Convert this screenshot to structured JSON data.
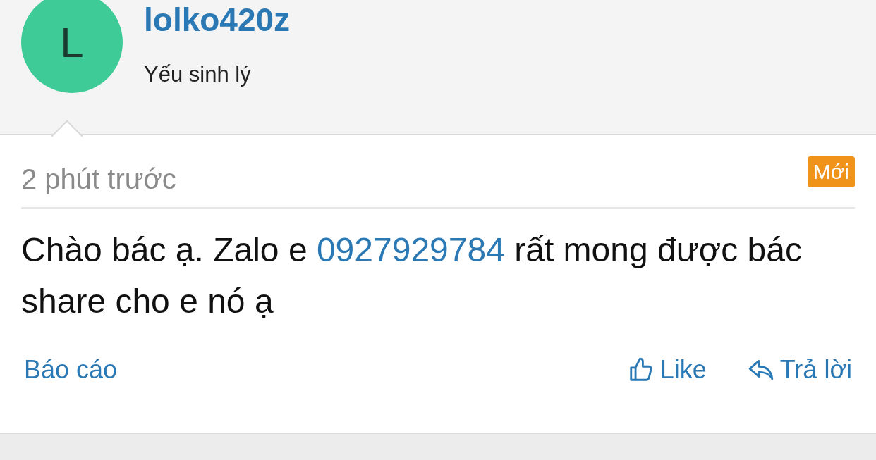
{
  "author": {
    "avatar_letter": "L",
    "username": "lolko420z",
    "title": "Yếu sinh lý"
  },
  "comment": {
    "time": "2 phút trước",
    "badge": "Mới",
    "text_before": "Chào bác ạ. Zalo e ",
    "phone": "0927929784",
    "text_after": " rất mong được bác share cho e nó ạ"
  },
  "actions": {
    "report": "Báo cáo",
    "like": "Like",
    "reply": "Trả lời"
  }
}
